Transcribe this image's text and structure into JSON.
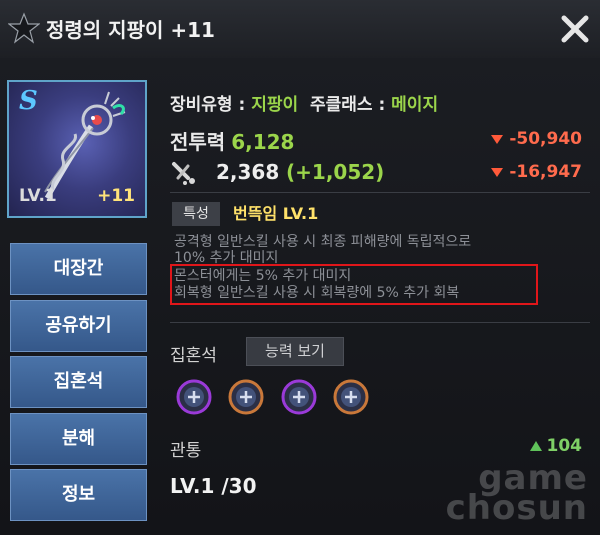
{
  "window": {
    "title": "정령의 지팡이 +11",
    "close_icon": "close-icon"
  },
  "item": {
    "grade": "S",
    "level": "LV.1",
    "enhance": "+11"
  },
  "menu": {
    "items": [
      "대장간",
      "공유하기",
      "집혼석",
      "분해",
      "정보"
    ]
  },
  "info": {
    "type_label": "장비유형 : ",
    "type_value": "지팡이",
    "subclass_label": "주클래스 : ",
    "subclass_value": "메이지",
    "power_label": "전투력",
    "power_value": "6,128",
    "power_diff": "-50,940",
    "attack_value": "2,368",
    "attack_bonus": "(+1,052)",
    "attack_diff": "-16,947"
  },
  "trait": {
    "tag": "특성",
    "name": "번뜩임  LV.1",
    "desc": [
      "공격형 일반스킬 사용 시 최종 피해량에 독립적으로",
      "10% 추가 대미지",
      "몬스터에게는 5% 추가 대미지",
      "회복형 일반스킬 사용 시 회복량에 5% 추가 회복"
    ]
  },
  "soul": {
    "label": "집혼석",
    "ability_button": "능력 보기",
    "slots": [
      {
        "ring": "#9a3ad8"
      },
      {
        "ring": "#c9783a"
      },
      {
        "ring": "#9a3ad8"
      },
      {
        "ring": "#c9783a"
      }
    ]
  },
  "pierce": {
    "label": "관통",
    "value": "104"
  },
  "level": {
    "text": "LV.1 /30"
  },
  "watermark": {
    "line1": "game",
    "line2": "chosun"
  },
  "colors": {
    "accent_green": "#9bd54b",
    "diff_red": "#ff6b4d",
    "highlight_red": "#e0161a",
    "button_blue": "#4a73a8"
  }
}
